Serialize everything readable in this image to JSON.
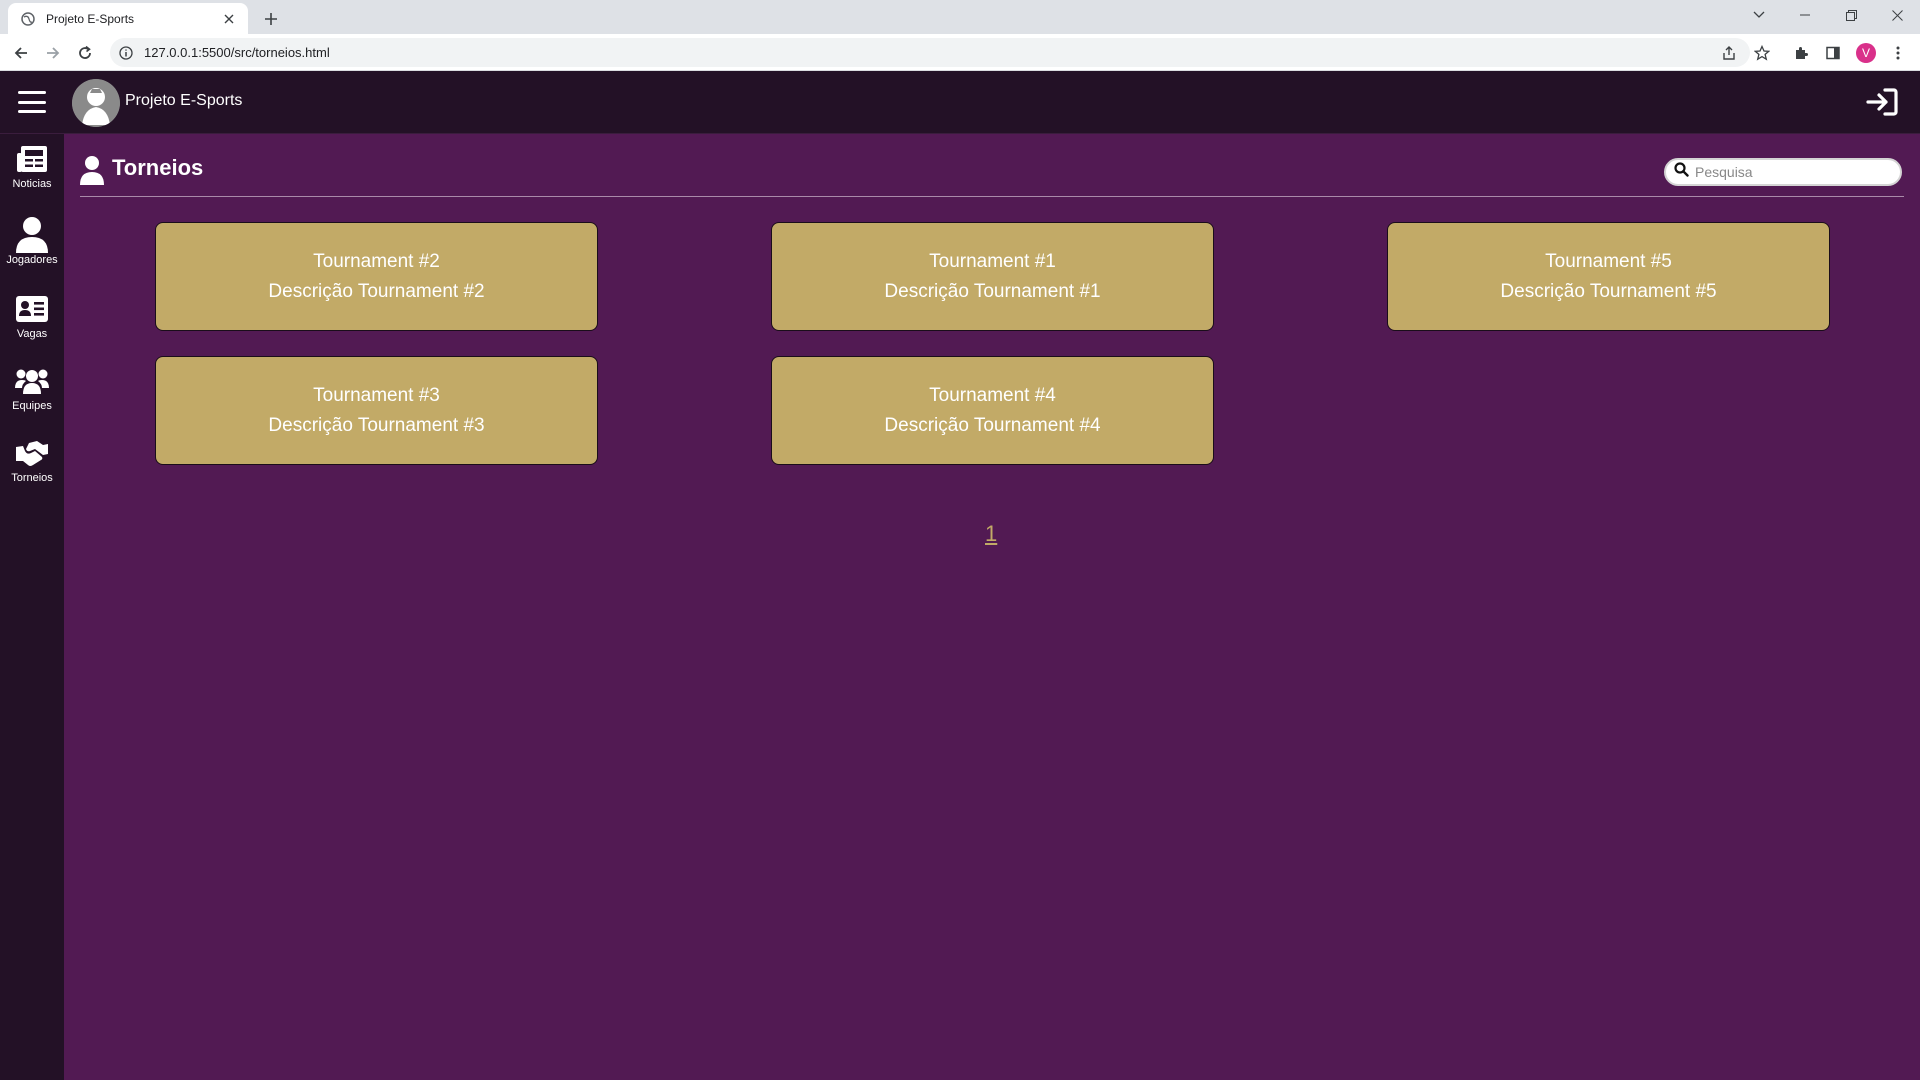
{
  "browser": {
    "tab_title": "Projeto E-Sports",
    "url": "127.0.0.1:5500/src/torneios.html",
    "profile_initial": "V"
  },
  "app": {
    "brand_name": "Projeto E-Sports",
    "colors": {
      "background": "#521a53",
      "nav": "#231126",
      "card": "#c2aa67",
      "accent": "#c2aa67"
    }
  },
  "sidebar": {
    "items": [
      {
        "label": "Noticias",
        "icon": "newspaper-icon"
      },
      {
        "label": "Jogadores",
        "icon": "user-icon"
      },
      {
        "label": "Vagas",
        "icon": "id-card-icon"
      },
      {
        "label": "Equipes",
        "icon": "users-group-icon"
      },
      {
        "label": "Torneios",
        "icon": "handshake-icon"
      }
    ]
  },
  "page": {
    "title": "Torneios",
    "icon": "user-icon",
    "search_placeholder": "Pesquisa"
  },
  "tournaments": [
    {
      "title": "Tournament #2",
      "description": "Descrição Tournament #2"
    },
    {
      "title": "Tournament #1",
      "description": "Descrição Tournament #1"
    },
    {
      "title": "Tournament #5",
      "description": "Descrição Tournament #5"
    },
    {
      "title": "Tournament #3",
      "description": "Descrição Tournament #3"
    },
    {
      "title": "Tournament #4",
      "description": "Descrição Tournament #4"
    }
  ],
  "pagination": {
    "current": "1"
  }
}
